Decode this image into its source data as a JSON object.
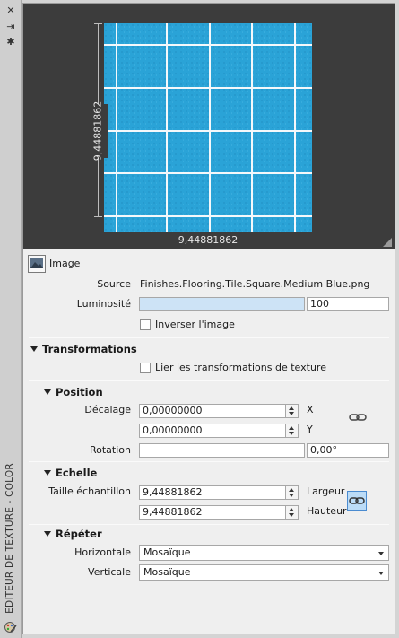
{
  "window": {
    "title": "EDITEUR DE TEXTURE - COLOR",
    "buttons": {
      "close": "✕",
      "pin": "⇥",
      "settings": "✱"
    }
  },
  "preview": {
    "width_label": "9,44881862",
    "height_label": "9,44881862",
    "texture_color": "#2aa3d7",
    "grout_color": "#f4f8fb"
  },
  "image": {
    "header": "Image",
    "source_label": "Source",
    "source_value": "Finishes.Flooring.Tile.Square.Medium Blue.png",
    "brightness_label": "Luminosité",
    "brightness_value": "100",
    "brightness_fill": 1.0,
    "invert_label": "Inverser l'image",
    "invert_checked": false
  },
  "transformations": {
    "header": "Transformations",
    "link_label": "Lier les transformations de texture",
    "link_checked": false,
    "position": {
      "header": "Position",
      "offset_label": "Décalage",
      "offset_x": "0,00000000",
      "x_label": "X",
      "offset_y": "0,00000000",
      "y_label": "Y",
      "rotation_label": "Rotation",
      "rotation_value": "0,00°"
    },
    "scale": {
      "header": "Echelle",
      "sample_size_label": "Taille échantillon",
      "width_value": "9,44881862",
      "width_label": "Largeur",
      "height_value": "9,44881862",
      "height_label": "Hauteur"
    },
    "repeat": {
      "header": "Répéter",
      "horizontal_label": "Horizontale",
      "horizontal_value": "Mosaïque",
      "vertical_label": "Verticale",
      "vertical_value": "Mosaïque"
    }
  }
}
